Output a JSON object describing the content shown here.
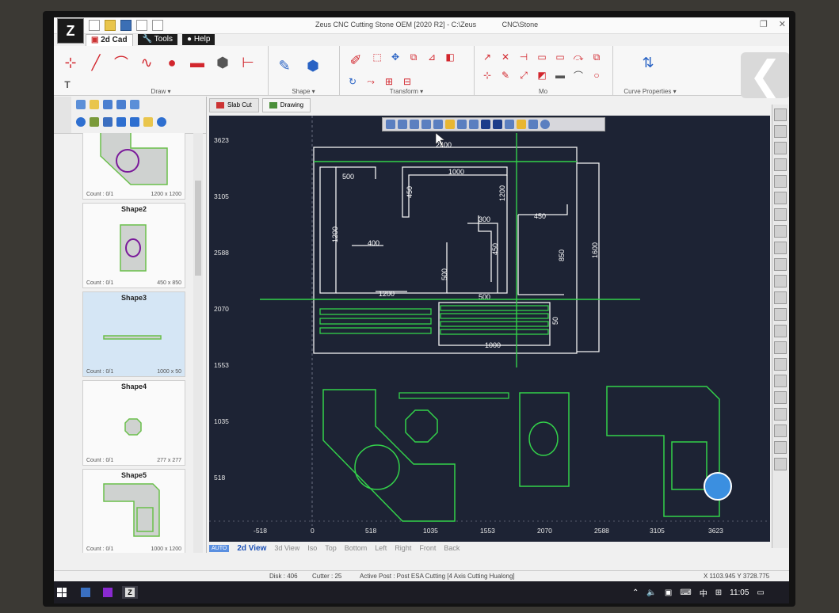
{
  "window": {
    "title": "Zeus CNC Cutting Stone OEM [2020 R2] - C:\\Zeus",
    "title_tail": "CNC\\Stone",
    "logo": "Z"
  },
  "menu": {
    "tabs": [
      {
        "label": "2d Cad",
        "active": true
      },
      {
        "label": "Tools",
        "active": false
      },
      {
        "label": "Help",
        "active": false
      }
    ]
  },
  "ribbon": {
    "groups": [
      {
        "label": "Draw ▾"
      },
      {
        "label": "Shape ▾"
      },
      {
        "label": "Transform ▾"
      },
      {
        "label": "Mo"
      },
      {
        "label": "Curve Properties ▾"
      }
    ]
  },
  "doc_tabs": [
    {
      "label": "Slab Cut"
    },
    {
      "label": "Drawing"
    }
  ],
  "shapes": [
    {
      "name": "",
      "count": "Count : 0/1",
      "size": "1200 x 1200"
    },
    {
      "name": "Shape2",
      "count": "Count : 0/1",
      "size": "450 x 850"
    },
    {
      "name": "Shape3",
      "count": "Count : 0/1",
      "size": "1000 x 50"
    },
    {
      "name": "Shape4",
      "count": "Count : 0/1",
      "size": "277 x 277"
    },
    {
      "name": "Shape5",
      "count": "Count : 0/1",
      "size": "1000 x 1200"
    }
  ],
  "canvas": {
    "y_ticks": [
      "3623",
      "3105",
      "2588",
      "2070",
      "1553",
      "1035",
      "518"
    ],
    "x_ticks": [
      "-518",
      "0",
      "518",
      "1035",
      "1553",
      "2070",
      "2588",
      "3105",
      "3623"
    ],
    "dims": {
      "d2400": "2400",
      "d1000a": "1000",
      "d500a": "500",
      "d450a": "450",
      "d1200a": "1200",
      "d300": "300",
      "d450b": "450",
      "d1200b": "1200",
      "d400": "400",
      "d450c": "450",
      "d850": "850",
      "d1600": "1600",
      "d500b": "500",
      "d1200c": "1200",
      "d500c": "500",
      "d50": "50",
      "d1000b": "1000"
    }
  },
  "view_tabs": {
    "auto": "AUTO",
    "items": [
      "2d View",
      "3d View",
      "Iso",
      "Top",
      "Bottom",
      "Left",
      "Right",
      "Front",
      "Back"
    ]
  },
  "status": {
    "disk": "Disk : 406",
    "cutter": "Cutter : 25",
    "post": "Active Post : Post ESA Cutting [4 Axis Cutting Hualong]",
    "coords": "X 1103.945   Y 3728.775"
  },
  "taskbar": {
    "tray": "中",
    "time": "11:05"
  },
  "colors": {
    "canvas_bg": "#1d2334",
    "shape_green": "#33d14a",
    "white": "#ffffff"
  }
}
